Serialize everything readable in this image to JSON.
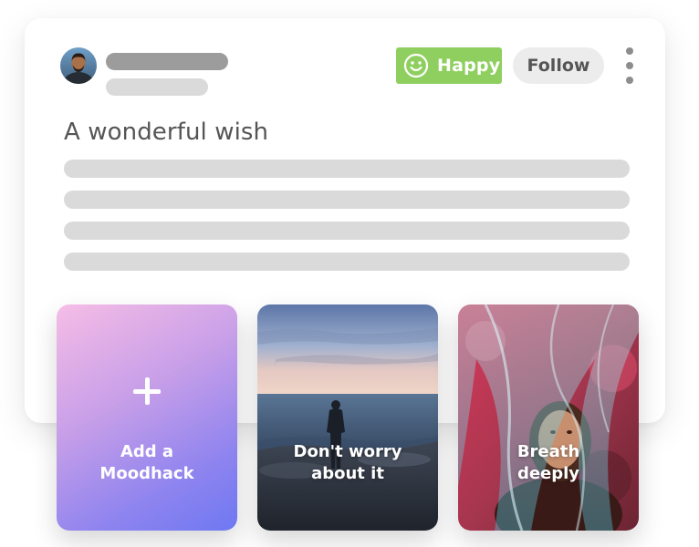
{
  "post": {
    "title": "A wonderful wish",
    "mood": {
      "label": "Happy",
      "icon": "smiley-face-icon",
      "color": "#8fcf5f"
    },
    "follow_label": "Follow",
    "menu_icon": "more-vertical-icon",
    "avatar_icon": "user-avatar-photo"
  },
  "moodhacks": [
    {
      "id": "add",
      "label_lines": [
        "Add a",
        "Moodhack"
      ],
      "icon": "plus-icon"
    },
    {
      "id": "worry",
      "label_lines": [
        "Don't worry",
        "about it"
      ],
      "image": "beach-silhouette-photo"
    },
    {
      "id": "breath",
      "label_lines": [
        "Breath",
        "deeply"
      ],
      "image": "woman-under-veil-photo"
    }
  ]
}
